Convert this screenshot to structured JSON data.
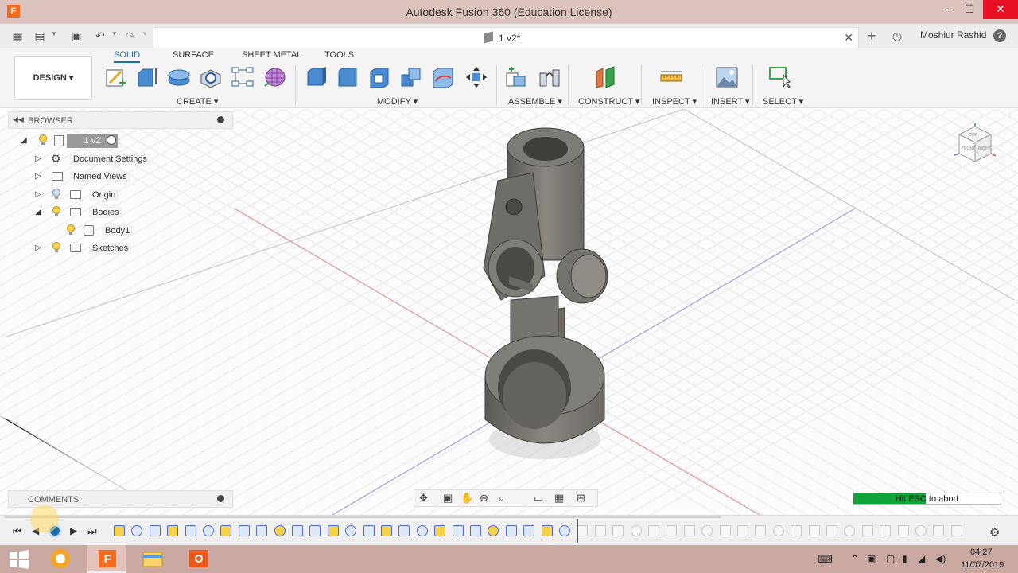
{
  "window": {
    "title": "Autodesk Fusion 360 (Education License)"
  },
  "tabbar": {
    "document_tab": "1 v2*",
    "user": "Moshiur Rashid"
  },
  "toolbar": {
    "workspace": "DESIGN",
    "tabs": [
      "SOLID",
      "SURFACE",
      "SHEET METAL",
      "TOOLS"
    ],
    "groups": [
      "CREATE",
      "MODIFY",
      "ASSEMBLE",
      "CONSTRUCT",
      "INSPECT",
      "INSERT",
      "SELECT"
    ]
  },
  "browser": {
    "header": "BROWSER",
    "root": "1 v2",
    "items": [
      "Document Settings",
      "Named Views",
      "Origin",
      "Bodies",
      "Body1",
      "Sketches"
    ]
  },
  "comments": {
    "header": "COMMENTS"
  },
  "status": {
    "progress_text": "Hit ESC to abort",
    "progress": 0.49
  },
  "viewcube": {
    "top": "TOP",
    "front": "FRONT",
    "right": "RIGHT"
  },
  "taskbar": {
    "time": "04:27",
    "date": "11/07/2019"
  },
  "colors": {
    "accent": "#1a6eb5",
    "close": "#e81123",
    "progress": "#0fa43a",
    "fusion": "#f26b1d"
  }
}
